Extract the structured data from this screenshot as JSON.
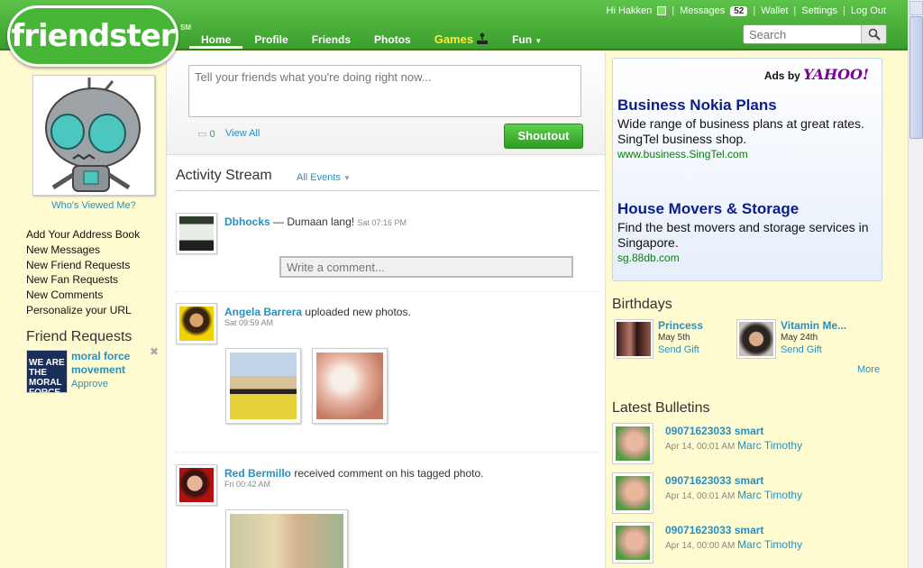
{
  "header": {
    "logo_text": "friendster",
    "logo_mark": "SM",
    "greeting": "Hi Hakken",
    "messages_label": "Messages",
    "messages_count": "52",
    "wallet": "Wallet",
    "settings": "Settings",
    "logout": "Log Out",
    "nav": [
      "Home",
      "Profile",
      "Friends",
      "Photos",
      "Games",
      "Fun"
    ],
    "search_placeholder": "Search"
  },
  "left": {
    "whos_viewed": "Who's Viewed Me?",
    "menu": [
      "Add Your Address Book",
      "New Messages",
      "New Friend Requests",
      "New Fan Requests",
      "New Comments",
      "Personalize your URL"
    ],
    "friend_requests_title": "Friend Requests",
    "friend_request": {
      "name": "moral force movement",
      "approve": "Approve",
      "thumb_text": "WE ARE THE MORAL FORCE"
    }
  },
  "center": {
    "status_placeholder": "Tell your friends what you're doing right now...",
    "comment_count": "0",
    "view_all": "View All",
    "shoutout": "Shoutout",
    "stream_title": "Activity Stream",
    "all_events": "All Events",
    "write_comment_placeholder": "Write a comment...",
    "activities": [
      {
        "name": "Dbhocks",
        "text": "— Dumaan lang!",
        "time": "Sat 07:16 PM"
      },
      {
        "name": "Angela Barrera",
        "text": "uploaded new photos.",
        "time": "Sat 09:59 AM"
      },
      {
        "name": "Red Bermillo",
        "text": "received comment on his tagged photo.",
        "time": "Fri 00:42 AM"
      }
    ]
  },
  "right": {
    "ads_by": "Ads by",
    "ads_brand": "YAHOO!",
    "ads": [
      {
        "title": "Business Nokia Plans",
        "desc": "Wide range of business plans at great rates. SingTel business shop.",
        "url": "www.business.SingTel.com"
      },
      {
        "title": "House Movers & Storage",
        "desc": "Find the best movers and storage services in Singapore.",
        "url": "sg.88db.com"
      }
    ],
    "birthdays_title": "Birthdays",
    "birthdays": [
      {
        "name": "Princess",
        "date": "May 5th",
        "gift": "Send Gift"
      },
      {
        "name": "Vitamin Me...",
        "date": "May 24th",
        "gift": "Send Gift"
      }
    ],
    "more": "More",
    "bulletins_title": "Latest Bulletins",
    "bulletins": [
      {
        "title": "09071623033 smart",
        "date": "Apr 14, 00:01 AM",
        "by": "Marc Timothy"
      },
      {
        "title": "09071623033 smart",
        "date": "Apr 14, 00:01 AM",
        "by": "Marc Timothy"
      },
      {
        "title": "09071623033 smart",
        "date": "Apr 14, 00:00 AM",
        "by": "Marc Timothy"
      }
    ]
  },
  "colors": {
    "brand_green": "#3a9e2c",
    "link_blue": "#2a8fbd",
    "ad_title": "#0b1d8a",
    "ad_url": "#0a7d0a",
    "page_bg": "#fffbd0"
  },
  "icons": [
    "online-status-icon",
    "search-icon",
    "joystick-icon",
    "dropdown-arrow-icon",
    "comment-bubble-icon",
    "close-icon"
  ]
}
